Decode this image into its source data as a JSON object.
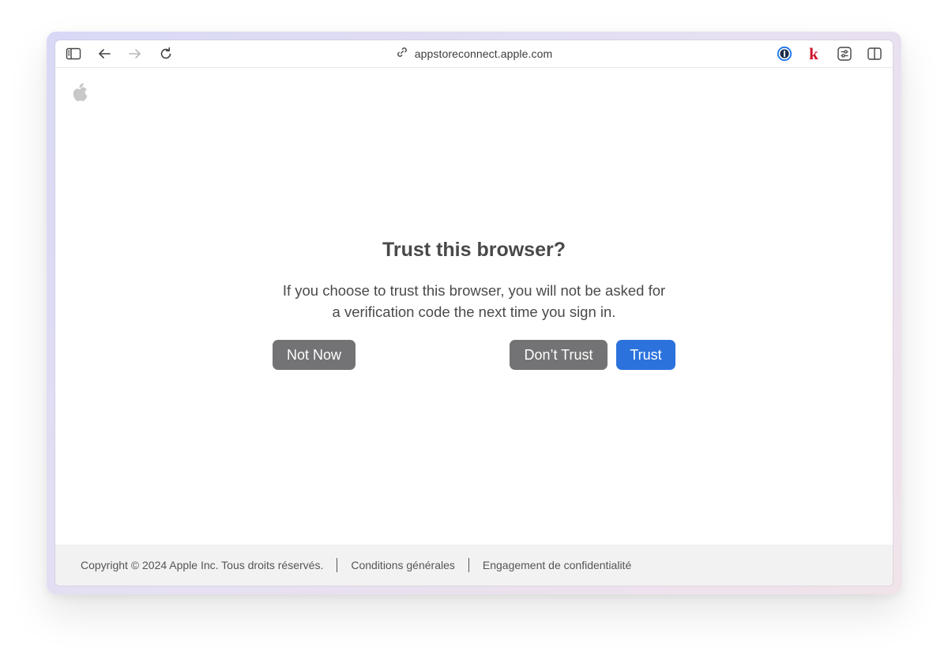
{
  "browser": {
    "address_url": "appstoreconnect.apple.com",
    "icons": {
      "sidebar": "sidebar-icon",
      "back": "arrow-left-icon",
      "forward": "arrow-right-icon",
      "reload": "reload-icon",
      "link": "link-icon",
      "password_manager": "1password-icon",
      "extension_k": "k-extension-icon",
      "settings": "sliders-icon",
      "split_view": "split-view-icon"
    },
    "extension_k_label": "k"
  },
  "page": {
    "logo": "apple-logo",
    "dialog": {
      "title": "Trust this browser?",
      "message_line1": "If you choose to trust this browser, you will not be asked for",
      "message_line2": "a verification code the next time you sign in.",
      "buttons": {
        "not_now": "Not Now",
        "dont_trust": "Don’t Trust",
        "trust": "Trust"
      }
    }
  },
  "footer": {
    "copyright": "Copyright © 2024 Apple Inc. Tous droits réservés.",
    "terms": "Conditions générales",
    "privacy": "Engagement de confidentialité"
  },
  "colors": {
    "primary_button": "#2b72dd",
    "secondary_button": "#737375",
    "footer_background": "#f2f2f2",
    "extension_k": "#d0112b",
    "password_manager": "#1a73e8"
  }
}
